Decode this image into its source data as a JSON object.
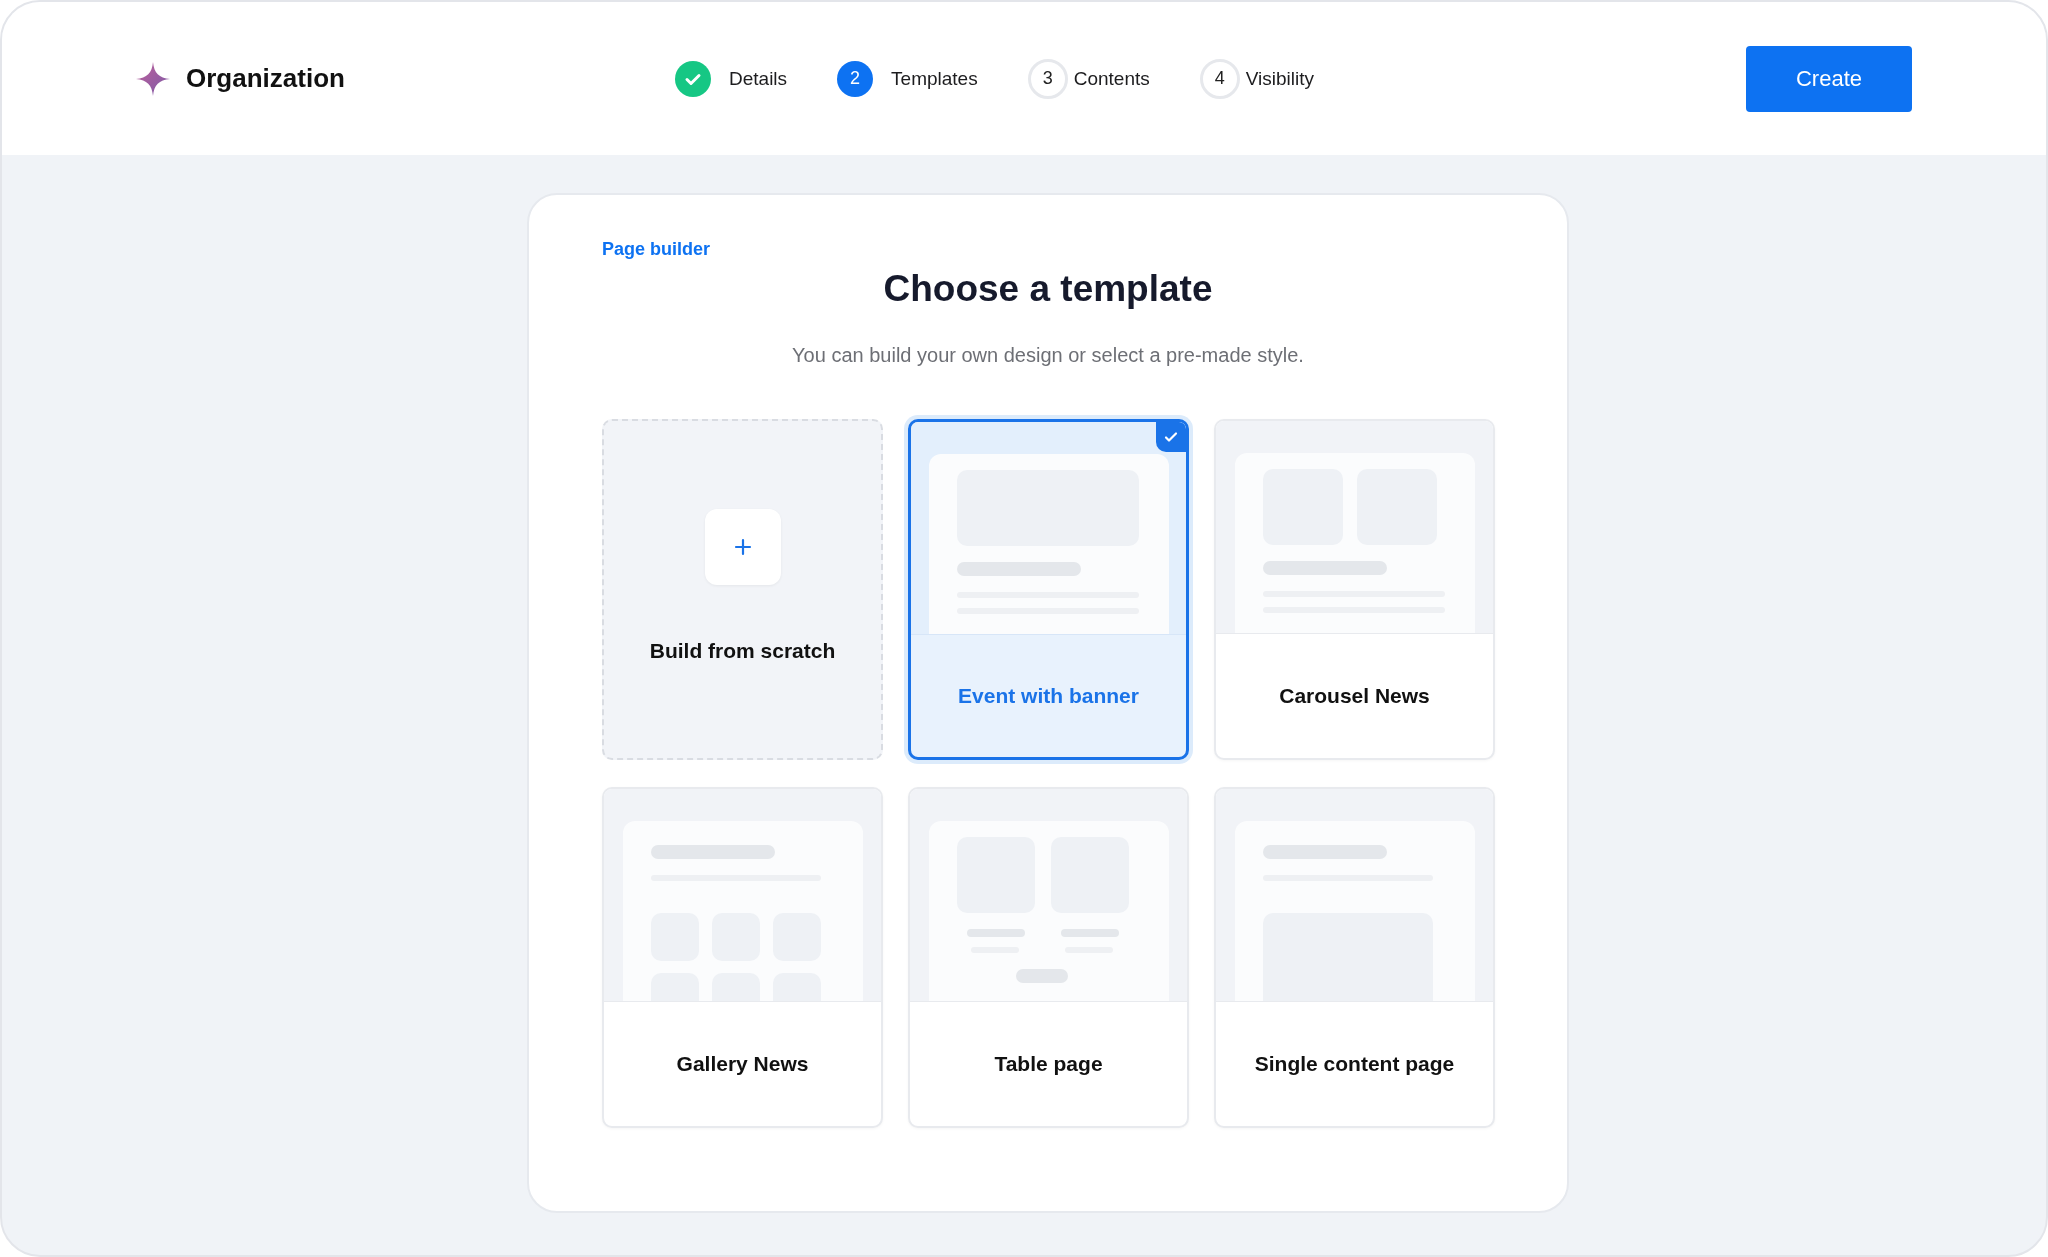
{
  "header": {
    "brand": "Organization",
    "create_button": "Create"
  },
  "steps": [
    {
      "label": "Details",
      "completed": true,
      "selected": false
    },
    {
      "number": "2",
      "label": "Templates",
      "completed": false,
      "selected": true
    },
    {
      "number": "3",
      "label": "Contents",
      "completed": false,
      "selected": false
    },
    {
      "number": "4",
      "label": "Visibility",
      "completed": false,
      "selected": false
    }
  ],
  "panel": {
    "eyebrow": "Page builder",
    "title": "Choose a template",
    "subtitle": "You can build your own design or select a pre-made style."
  },
  "templates": [
    {
      "kind": "scratch",
      "label": "Build from scratch",
      "selected": false
    },
    {
      "kind": "banner",
      "label": "Event with banner",
      "selected": true
    },
    {
      "kind": "carousel",
      "label": "Carousel News",
      "selected": false
    },
    {
      "kind": "gallery",
      "label": "Gallery News",
      "selected": false
    },
    {
      "kind": "table",
      "label": "Table page",
      "selected": false
    },
    {
      "kind": "single",
      "label": "Single content page",
      "selected": false
    }
  ]
}
